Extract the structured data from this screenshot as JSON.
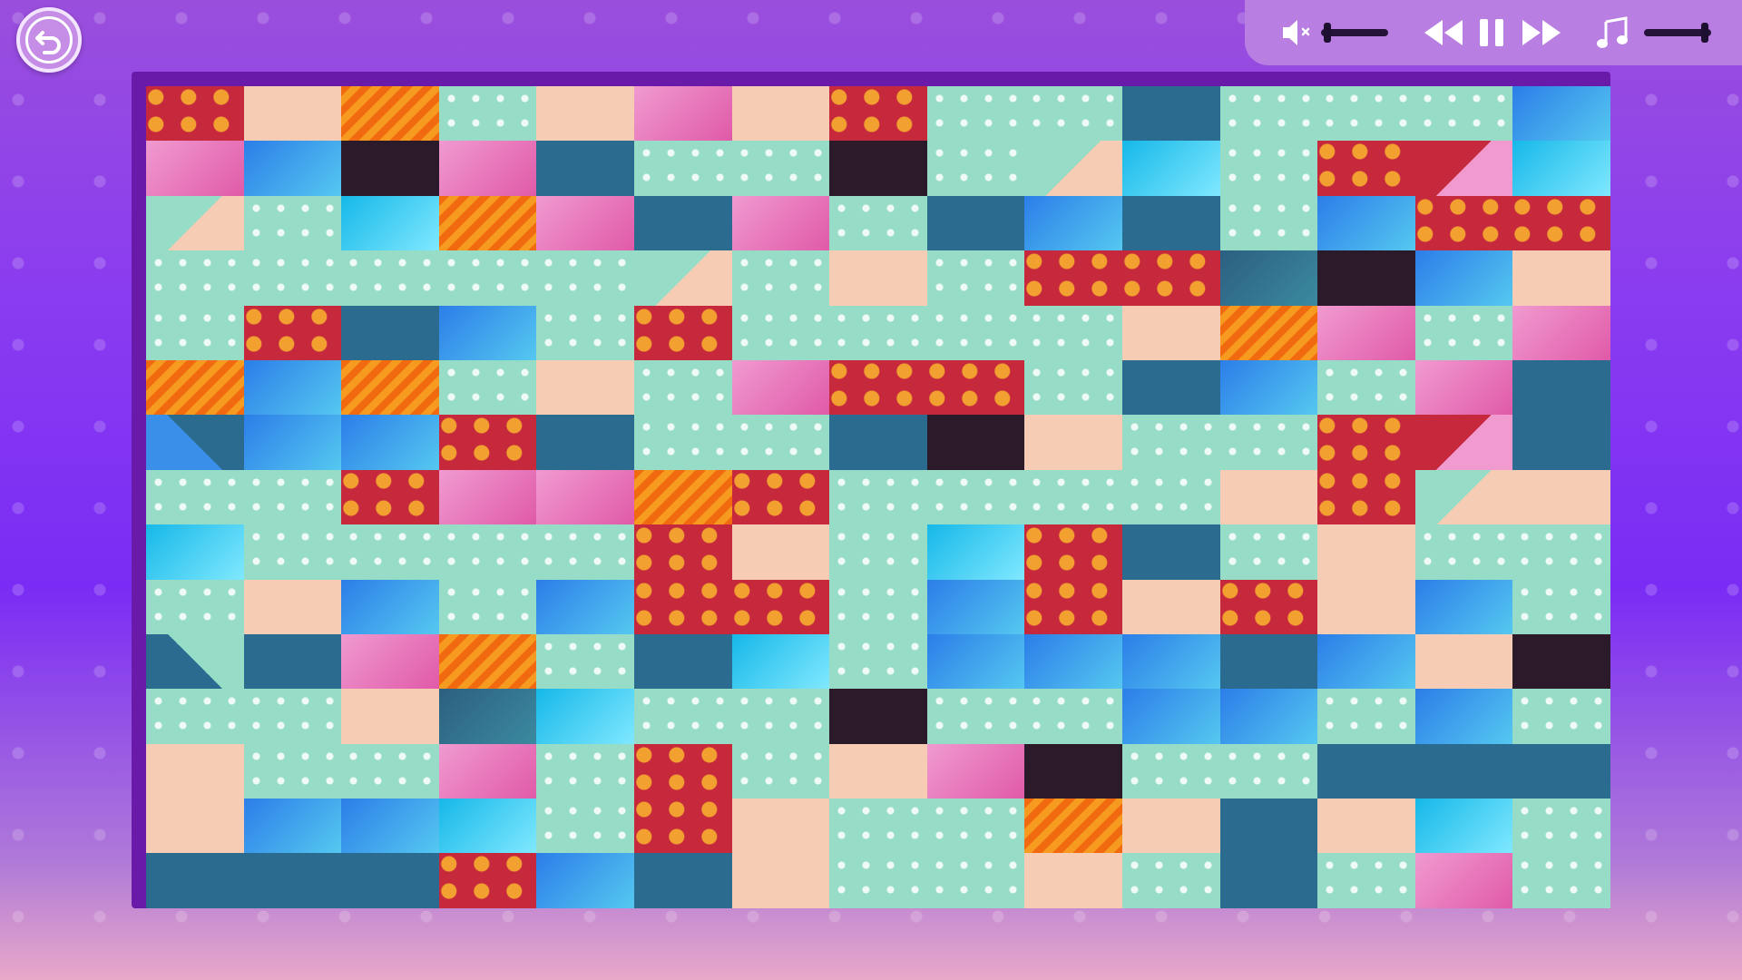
{
  "controls": {
    "back_icon": "undo-arrow-icon",
    "mute_icon": "speaker-mute-icon",
    "sound_volume": 0.05,
    "rewind_icon": "rewind-icon",
    "pause_icon": "pause-icon",
    "forward_icon": "fast-forward-icon",
    "music_icon": "music-note-icon",
    "music_volume": 0.95
  },
  "puzzle": {
    "columns": 15,
    "rows": 15,
    "tiles": [
      "red",
      "skin",
      "orange",
      "dots",
      "skin",
      "pink",
      "skin",
      "red",
      "dots",
      "dots",
      "navy",
      "dots",
      "dots",
      "dots",
      "blue",
      "pink",
      "blue",
      "dark",
      "pink",
      "navy",
      "dots",
      "dots",
      "dark",
      "dots",
      "mix1",
      "cyan",
      "dots",
      "red",
      "mix3",
      "cyan",
      "mix1",
      "dots",
      "cyan",
      "orange",
      "pink",
      "navy",
      "pink",
      "dots",
      "navy",
      "blue",
      "navy",
      "dots",
      "blue",
      "red",
      "red",
      "dots",
      "dots",
      "dots",
      "dots",
      "dots",
      "mix1",
      "dots",
      "skin",
      "dots",
      "red",
      "red",
      "teal",
      "dark",
      "blue",
      "skin",
      "dots",
      "red",
      "navy",
      "blue",
      "dots",
      "red",
      "dots",
      "dots",
      "dots",
      "dots",
      "skin",
      "orange",
      "pink",
      "dots",
      "pink",
      "orange",
      "blue",
      "orange",
      "dots",
      "skin",
      "dots",
      "pink",
      "red",
      "red",
      "dots",
      "navy",
      "blue",
      "dots",
      "pink",
      "navy",
      "mix4",
      "blue",
      "blue",
      "red",
      "navy",
      "dots",
      "dots",
      "navy",
      "dark",
      "skin",
      "dots",
      "dots",
      "red",
      "mix3",
      "navy",
      "dots",
      "dots",
      "red",
      "pink",
      "pink",
      "orange",
      "red",
      "dots",
      "dots",
      "dots",
      "dots",
      "skin",
      "red",
      "mix1",
      "skin",
      "cyan",
      "dots",
      "dots",
      "dots",
      "dots",
      "red",
      "skin",
      "dots",
      "cyan",
      "red",
      "navy",
      "dots",
      "skin",
      "dots",
      "dots",
      "dots",
      "skin",
      "blue",
      "dots",
      "blue",
      "red",
      "red",
      "dots",
      "blue",
      "red",
      "skin",
      "red",
      "skin",
      "blue",
      "dots",
      "mix2",
      "navy",
      "pink",
      "orange",
      "dots",
      "navy",
      "cyan",
      "dots",
      "blue",
      "blue",
      "blue",
      "navy",
      "blue",
      "skin",
      "dark",
      "dots",
      "dots",
      "skin",
      "teal",
      "cyan",
      "dots",
      "dots",
      "dark",
      "dots",
      "dots",
      "blue",
      "blue",
      "dots",
      "blue",
      "dots",
      "skin",
      "dots",
      "dots",
      "pink",
      "dots",
      "red",
      "dots",
      "skin",
      "pink",
      "dark",
      "dots",
      "dots",
      "navy",
      "navy",
      "navy",
      "skin",
      "blue",
      "blue",
      "cyan",
      "dots",
      "red",
      "skin",
      "dots",
      "dots",
      "orange",
      "skin",
      "navy",
      "skin",
      "cyan",
      "dots",
      "navy",
      "navy",
      "navy",
      "red",
      "blue",
      "navy",
      "skin",
      "dots",
      "dots",
      "skin",
      "dots",
      "navy",
      "dots",
      "pink",
      "dots"
    ]
  }
}
